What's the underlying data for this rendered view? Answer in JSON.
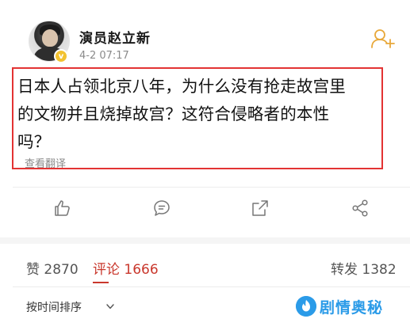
{
  "user": {
    "name": "演员赵立新",
    "time": "4-2 07:17",
    "badge": "v"
  },
  "post": {
    "line1": "日本人占领北京八年，为什么没有抢走故宫里",
    "line2": "的文物并且烧掉故宫？这符合侵略者的本性",
    "line3": "吗？",
    "translate_label": "查看翻译"
  },
  "actions": {
    "icons": [
      "thumbs-up-icon",
      "comment-icon",
      "share-icon",
      "share-network-icon"
    ]
  },
  "stats": {
    "likes_label": "赞",
    "likes_count": "2870",
    "comments_label": "评论",
    "comments_count": "1666",
    "reposts_label": "转发",
    "reposts_count": "1382"
  },
  "sort": {
    "label": "按时间排序"
  },
  "watermark": {
    "text": "剧情奥秘"
  },
  "colors": {
    "highlight": "#e33333",
    "active_tab": "#c9372c",
    "badge": "#f2c230",
    "follow_icon": "#e8a83a",
    "watermark": "#2b9be8"
  }
}
